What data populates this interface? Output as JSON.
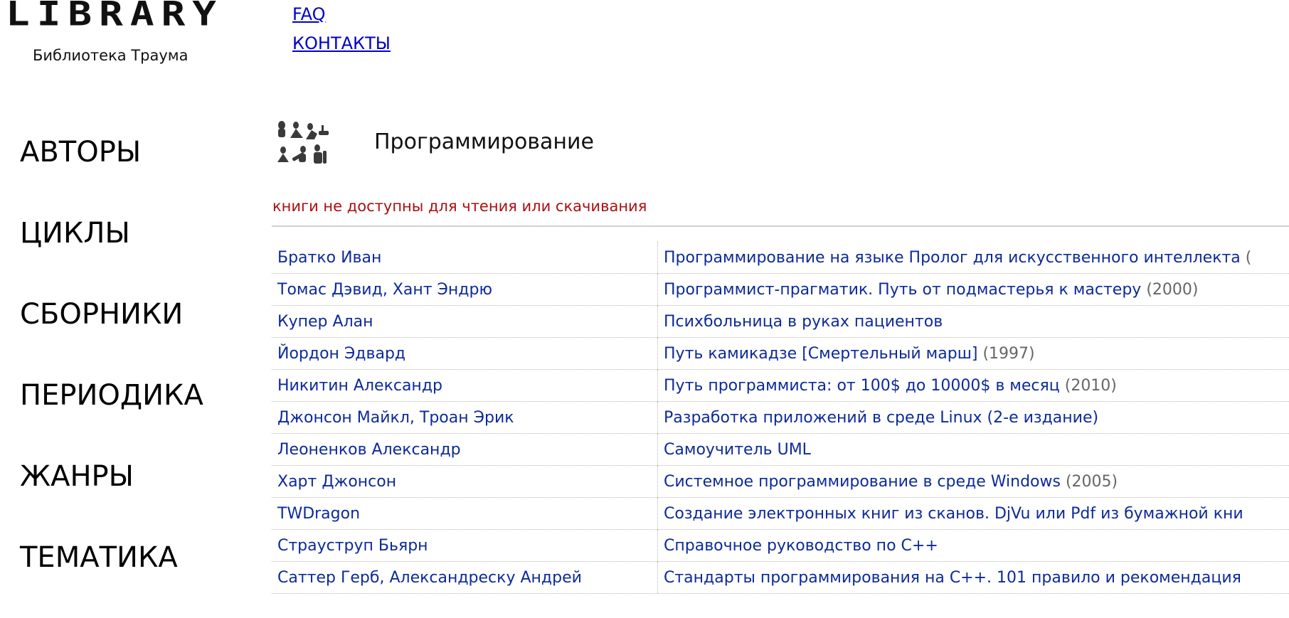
{
  "site": {
    "logo": "LIBRARY",
    "subtitle": "Библиотека Траума"
  },
  "top_links": [
    {
      "label": "FAQ"
    },
    {
      "label": "КОНТАКТЫ"
    }
  ],
  "side_nav": [
    {
      "label": "АВТОРЫ"
    },
    {
      "label": "ЦИКЛЫ"
    },
    {
      "label": "СБОРНИКИ"
    },
    {
      "label": "ПЕРИОДИКА"
    },
    {
      "label": "ЖАНРЫ"
    },
    {
      "label": "ТЕМАТИКА"
    }
  ],
  "genre": {
    "title": "Программирование",
    "icon": "reading-figures-icon"
  },
  "notice": "книги не доступны для чтения или скачивания",
  "colors": {
    "link": "#0d2a99",
    "notice": "#a81010",
    "year": "#666666"
  },
  "books": [
    {
      "authors": [
        "Братко Иван"
      ],
      "title": "Программирование на языке Пролог для искусственного интеллекта",
      "year": "("
    },
    {
      "authors": [
        "Томас Дэвид",
        "Хант Эндрю"
      ],
      "title": "Программист-прагматик. Путь от подмастерья к мастеру",
      "year": "(2000)"
    },
    {
      "authors": [
        "Купер Алан"
      ],
      "title": "Психбольница в руках пациентов",
      "year": ""
    },
    {
      "authors": [
        "Йордон Эдвард"
      ],
      "title": "Путь камикадзе [Смертельный марш]",
      "year": "(1997)"
    },
    {
      "authors": [
        "Никитин Александр"
      ],
      "title": "Путь программиста: от 100$ до 10000$ в месяц",
      "year": "(2010)"
    },
    {
      "authors": [
        "Джонсон Майкл",
        "Троан Эрик"
      ],
      "title": "Разработка приложений в среде Linux (2-е издание)",
      "year": ""
    },
    {
      "authors": [
        "Леоненков Александр"
      ],
      "title": "Самоучитель UML",
      "year": ""
    },
    {
      "authors": [
        "Харт Джонсон"
      ],
      "title": "Системное программирование в среде Windows",
      "year": "(2005)"
    },
    {
      "authors": [
        "TWDragon"
      ],
      "title": "Создание электронных книг из сканов. DjVu или Pdf из бумажной кни",
      "year": ""
    },
    {
      "authors": [
        "Страуструп Бьярн"
      ],
      "title": "Справочное руководство по C++",
      "year": ""
    },
    {
      "authors": [
        "Саттер Герб",
        "Александреску Андрей"
      ],
      "title": "Стандарты программирования на С++. 101 правило и рекомендация",
      "year": ""
    }
  ]
}
